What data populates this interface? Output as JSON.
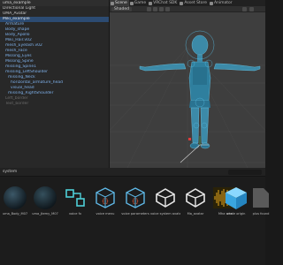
{
  "hierarchy": {
    "scene_label": "uma_example",
    "items": [
      {
        "label": "Directional Light",
        "level": 1,
        "style": "normal"
      },
      {
        "label": "UMA_Avatar",
        "level": 1,
        "style": "normal"
      },
      {
        "label": "Miki_example",
        "level": 1,
        "style": "selected"
      },
      {
        "label": "Armature",
        "level": 2,
        "style": "blue"
      },
      {
        "label": "Body_shape",
        "level": 2,
        "style": "blue"
      },
      {
        "label": "Body_Apollo",
        "level": 2,
        "style": "blue"
      },
      {
        "label": "Miki_Hair.v02",
        "level": 2,
        "style": "blue"
      },
      {
        "label": "mesh_Eyelash.v02",
        "level": 2,
        "style": "blue"
      },
      {
        "label": "mesh_Face",
        "level": 2,
        "style": "blue"
      },
      {
        "label": "Missing_Eyes",
        "level": 2,
        "style": "blue"
      },
      {
        "label": "Missing_Spine",
        "level": 2,
        "style": "blue"
      },
      {
        "label": "missing_Spine1",
        "level": 2,
        "style": "blue"
      },
      {
        "label": "missing_LeftShoulder",
        "level": 2,
        "style": "blue"
      },
      {
        "label": "missing_Neck",
        "level": 3,
        "style": "blue"
      },
      {
        "label": "horizontal_armature_head",
        "level": 4,
        "style": "blue"
      },
      {
        "label": "visual_head",
        "level": 4,
        "style": "blue"
      },
      {
        "label": "missing_RightShoulder",
        "level": 3,
        "style": "blue"
      },
      {
        "label": "Left_border",
        "level": 2,
        "style": "dim"
      },
      {
        "label": "Text_border",
        "level": 2,
        "style": "dim"
      }
    ]
  },
  "tabs": [
    {
      "label": "Scene",
      "active": true
    },
    {
      "label": "Game",
      "active": false
    },
    {
      "label": "VRChat SDK",
      "active": false
    },
    {
      "label": "Asset Store",
      "active": false
    },
    {
      "label": "Animator",
      "active": false
    }
  ],
  "toolbar": {
    "shading_mode": "Shaded"
  },
  "project": {
    "path": "system",
    "assets": [
      {
        "label": "uma_Body_M07",
        "icon": "sphere-dark-icon"
      },
      {
        "label": "uma_Jtemy_M07",
        "icon": "sphere-dark-icon"
      },
      {
        "label": "voice fx",
        "icon": "blend-tree-icon"
      },
      {
        "label": "voice menu",
        "icon": "scriptable-object-icon"
      },
      {
        "label": "voice parameters",
        "icon": "scriptable-object-icon"
      },
      {
        "label": "voice system avatar",
        "icon": "unity-logo-icon"
      },
      {
        "label": "Ma_avatar",
        "icon": "unity-logo-icon"
      },
      {
        "label": "Mha wha",
        "icon": "audio-waveform-icon"
      },
      {
        "label": "seele origin",
        "icon": "cube-icon"
      },
      {
        "label": "plus found",
        "icon": "file-icon"
      }
    ]
  },
  "colors": {
    "selection": "#2c4b72",
    "hierarchy_blue": "#7fb2ec",
    "character_teal": "#3c8aa8",
    "audio_gold": "#e7a51c",
    "cube_blue": "#4fb8f0"
  }
}
